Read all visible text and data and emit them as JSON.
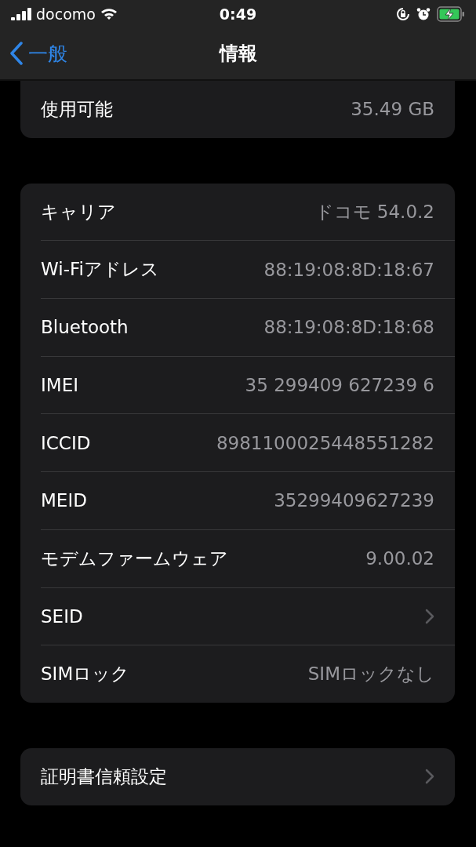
{
  "status_bar": {
    "carrier": "docomo",
    "time": "0:49"
  },
  "nav": {
    "back": "一般",
    "title": "情報"
  },
  "groups": [
    {
      "cut_top": true,
      "rows": [
        {
          "kind": "value",
          "label": "使用可能",
          "value": "35.49 GB"
        }
      ]
    },
    {
      "cut_top": false,
      "rows": [
        {
          "kind": "value",
          "label": "キャリア",
          "value": "ドコモ 54.0.2"
        },
        {
          "kind": "value",
          "label": "Wi-Fiアドレス",
          "value": "88:19:08:8D:18:67"
        },
        {
          "kind": "value",
          "label": "Bluetooth",
          "value": "88:19:08:8D:18:68"
        },
        {
          "kind": "value",
          "label": "IMEI",
          "value": "35 299409 627239 6"
        },
        {
          "kind": "value",
          "label": "ICCID",
          "value": "8981100025448551282"
        },
        {
          "kind": "value",
          "label": "MEID",
          "value": "35299409627239"
        },
        {
          "kind": "value",
          "label": "モデムファームウェア",
          "value": "9.00.02"
        },
        {
          "kind": "link",
          "label": "SEID"
        },
        {
          "kind": "value",
          "label": "SIMロック",
          "value": "SIMロックなし"
        }
      ]
    },
    {
      "cut_top": false,
      "rows": [
        {
          "kind": "link",
          "label": "証明書信頼設定"
        }
      ]
    }
  ]
}
